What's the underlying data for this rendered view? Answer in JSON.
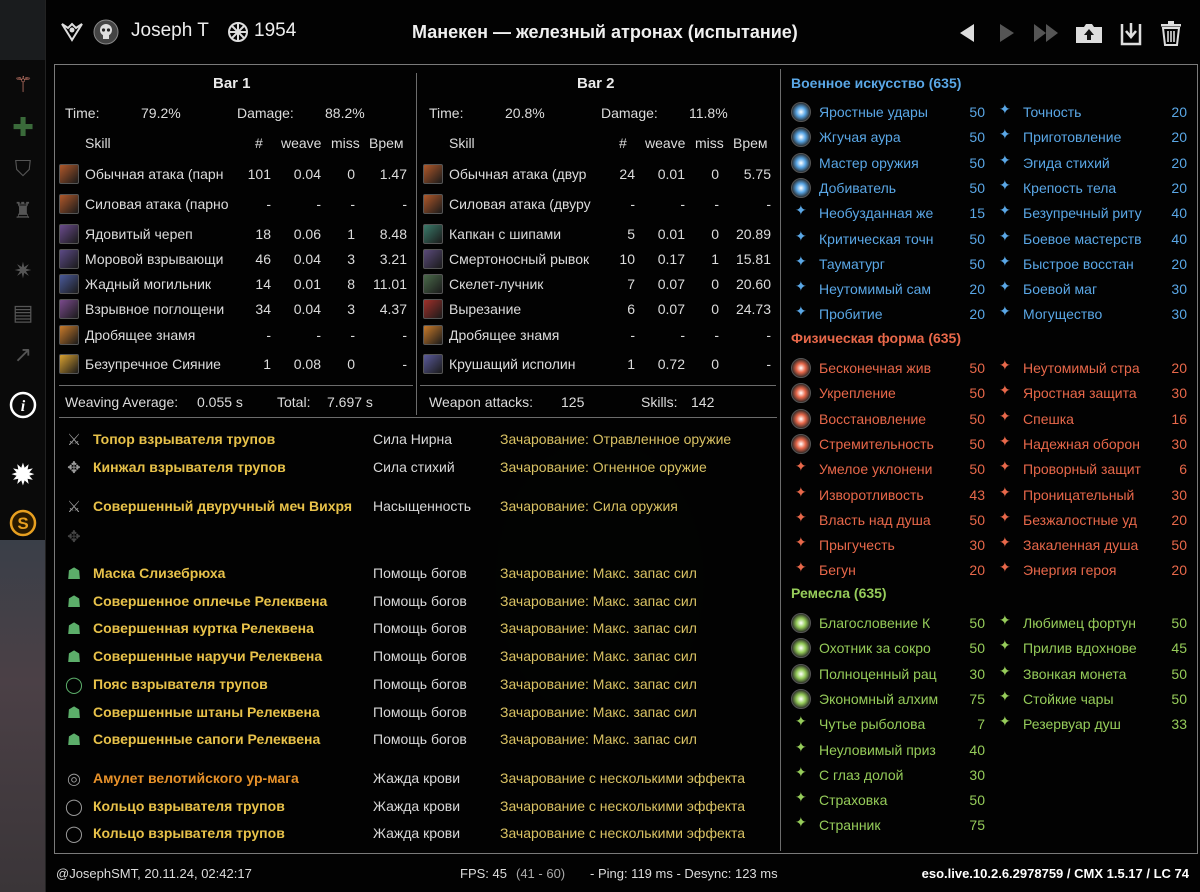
{
  "header": {
    "player": "Joseph T",
    "score": "1954",
    "title": "Манекен — железный атронах (испытание)"
  },
  "bar1": {
    "title": "Bar 1",
    "time_label": "Time:",
    "time_value": "79.2%",
    "damage_label": "Damage:",
    "damage_value": "88.2%",
    "cols": {
      "skill": "Skill",
      "num": "#",
      "weave": "weave",
      "miss": "miss",
      "time": "Врем"
    },
    "rows": [
      {
        "name": "Обычная атака (парн",
        "num": "101",
        "weave": "0.04",
        "miss": "0",
        "time": "1.47",
        "color": "#b0582a"
      },
      {
        "name": "Силовая атака (парно",
        "num": "-",
        "weave": "-",
        "miss": "-",
        "time": "-",
        "color": "#b0582a"
      },
      {
        "name": "Ядовитый череп",
        "num": "18",
        "weave": "0.06",
        "miss": "1",
        "time": "8.48",
        "color": "#6a4b8c"
      },
      {
        "name": "Моровой взрывающи",
        "num": "46",
        "weave": "0.04",
        "miss": "3",
        "time": "3.21",
        "color": "#5c4a86"
      },
      {
        "name": "Жадный могильник",
        "num": "14",
        "weave": "0.01",
        "miss": "8",
        "time": "11.01",
        "color": "#4a5a9a"
      },
      {
        "name": "Взрывное поглощени",
        "num": "34",
        "weave": "0.04",
        "miss": "3",
        "time": "4.37",
        "color": "#7a4a8c"
      },
      {
        "name": "Дробящее знамя",
        "num": "-",
        "weave": "-",
        "miss": "-",
        "time": "-",
        "color": "#c87a2a"
      },
      {
        "name": "Безупречное Сияние",
        "num": "1",
        "weave": "0.08",
        "miss": "0",
        "time": "-",
        "color": "#d8a030"
      }
    ],
    "footer_left_label": "Weaving Average:",
    "footer_left_value": "0.055 s",
    "footer_right_label": "Total:",
    "footer_right_value": "7.697 s"
  },
  "bar2": {
    "title": "Bar 2",
    "time_label": "Time:",
    "time_value": "20.8%",
    "damage_label": "Damage:",
    "damage_value": "11.8%",
    "cols": {
      "skill": "Skill",
      "num": "#",
      "weave": "weave",
      "miss": "miss",
      "time": "Врем"
    },
    "rows": [
      {
        "name": "Обычная атака (двур",
        "num": "24",
        "weave": "0.01",
        "miss": "0",
        "time": "5.75",
        "color": "#b0582a"
      },
      {
        "name": "Силовая атака (двуру",
        "num": "-",
        "weave": "-",
        "miss": "-",
        "time": "-",
        "color": "#b0582a"
      },
      {
        "name": "Капкан с шипами",
        "num": "5",
        "weave": "0.01",
        "miss": "0",
        "time": "20.89",
        "color": "#3a7a6a"
      },
      {
        "name": "Смертоносный рывок",
        "num": "10",
        "weave": "0.17",
        "miss": "1",
        "time": "15.81",
        "color": "#5a4a7a"
      },
      {
        "name": "Скелет-лучник",
        "num": "7",
        "weave": "0.07",
        "miss": "0",
        "time": "20.60",
        "color": "#4a6a4a"
      },
      {
        "name": "Вырезание",
        "num": "6",
        "weave": "0.07",
        "miss": "0",
        "time": "24.73",
        "color": "#a0302a"
      },
      {
        "name": "Дробящее знамя",
        "num": "-",
        "weave": "-",
        "miss": "-",
        "time": "-",
        "color": "#c87a2a"
      },
      {
        "name": "Крушащий исполин",
        "num": "1",
        "weave": "0.72",
        "miss": "0",
        "time": "-",
        "color": "#5a5a9a"
      }
    ],
    "footer_left_label": "Weapon attacks:",
    "footer_left_value": "125",
    "footer_right_label": "Skills:",
    "footer_right_value": "142"
  },
  "gear": [
    {
      "name": "Топор взрывателя трупов",
      "trait": "Сила Нирна",
      "ench": "Зачарование: Отравленное оружие",
      "icon": "⚔",
      "name_color": "#e8c24a"
    },
    {
      "name": "Кинжал взрывателя трупов",
      "trait": "Сила стихий",
      "ench": "Зачарование: Огненное оружие",
      "icon": "✥",
      "name_color": "#e8c24a"
    },
    {
      "name": "Совершенный двуручный меч Вихря",
      "trait": "Насыщенность",
      "ench": "Зачарование: Сила оружия",
      "icon": "⚔",
      "name_color": "#e8c24a"
    },
    {
      "name": "Маска Слизебрюха",
      "trait": "Помощь богов",
      "ench": "Зачарование: Макс. запас сил",
      "icon": "☗",
      "name_color": "#e8c24a"
    },
    {
      "name": "Совершенное оплечье Релеквена",
      "trait": "Помощь богов",
      "ench": "Зачарование: Макс. запас сил",
      "icon": "☗",
      "name_color": "#e8c24a"
    },
    {
      "name": "Совершенная куртка Релеквена",
      "trait": "Помощь богов",
      "ench": "Зачарование: Макс. запас сил",
      "icon": "☗",
      "name_color": "#e8c24a"
    },
    {
      "name": "Совершенные наручи Релеквена",
      "trait": "Помощь богов",
      "ench": "Зачарование: Макс. запас сил",
      "icon": "☗",
      "name_color": "#e8c24a"
    },
    {
      "name": "Пояс взрывателя трупов",
      "trait": "Помощь богов",
      "ench": "Зачарование: Макс. запас сил",
      "icon": "◯",
      "name_color": "#e8c24a"
    },
    {
      "name": "Совершенные штаны Релеквена",
      "trait": "Помощь богов",
      "ench": "Зачарование: Макс. запас сил",
      "icon": "☗",
      "name_color": "#e8c24a"
    },
    {
      "name": "Совершенные сапоги Релеквена",
      "trait": "Помощь богов",
      "ench": "Зачарование: Макс. запас сил",
      "icon": "☗",
      "name_color": "#e8c24a"
    },
    {
      "name": "Амулет велотийского ур-мага",
      "trait": "Жажда крови",
      "ench": "Зачарование с несколькими эффекта",
      "icon": "◎",
      "name_color": "#e8922a"
    },
    {
      "name": "Кольцо взрывателя трупов",
      "trait": "Жажда крови",
      "ench": "Зачарование с несколькими эффекта",
      "icon": "◯",
      "name_color": "#e8c24a"
    },
    {
      "name": "Кольцо взрывателя трупов",
      "trait": "Жажда крови",
      "ench": "Зачарование с несколькими эффекта",
      "icon": "◯",
      "name_color": "#e8c24a"
    }
  ],
  "cp": {
    "warfare": {
      "title": "Военное искусство (635)",
      "color": "#5aa7e6",
      "left": [
        {
          "name": "Яростные удары",
          "value": "50",
          "slotted": true
        },
        {
          "name": "Жгучая аура",
          "value": "50",
          "slotted": true
        },
        {
          "name": "Мастер оружия",
          "value": "50",
          "slotted": true
        },
        {
          "name": "Добиватель",
          "value": "50",
          "slotted": true
        },
        {
          "name": "Необузданная же",
          "value": "15",
          "slotted": false
        },
        {
          "name": "Критическая точн",
          "value": "50",
          "slotted": false
        },
        {
          "name": "Тауматург",
          "value": "50",
          "slotted": false
        },
        {
          "name": "Неутомимый сам",
          "value": "20",
          "slotted": false
        },
        {
          "name": "Пробитие",
          "value": "20",
          "slotted": false
        }
      ],
      "right": [
        {
          "name": "Точность",
          "value": "20"
        },
        {
          "name": "Приготовление",
          "value": "20"
        },
        {
          "name": "Эгида стихий",
          "value": "20"
        },
        {
          "name": "Крепость тела",
          "value": "20"
        },
        {
          "name": "Безупречный риту",
          "value": "40"
        },
        {
          "name": "Боевое мастерств",
          "value": "40"
        },
        {
          "name": "Быстрое восстан",
          "value": "20"
        },
        {
          "name": "Боевой маг",
          "value": "30"
        },
        {
          "name": "Могущество",
          "value": "30"
        }
      ]
    },
    "fitness": {
      "title": "Физическая форма (635)",
      "color": "#e8684a",
      "left": [
        {
          "name": "Бесконечная жив",
          "value": "50",
          "slotted": true
        },
        {
          "name": "Укрепление",
          "value": "50",
          "slotted": true
        },
        {
          "name": "Восстановление",
          "value": "50",
          "slotted": true
        },
        {
          "name": "Стремительность",
          "value": "50",
          "slotted": true
        },
        {
          "name": "Умелое уклонени",
          "value": "50",
          "slotted": false
        },
        {
          "name": "Изворотливость",
          "value": "43",
          "slotted": false
        },
        {
          "name": "Власть над душа",
          "value": "50",
          "slotted": false
        },
        {
          "name": "Прыгучесть",
          "value": "30",
          "slotted": false
        },
        {
          "name": "Бегун",
          "value": "20",
          "slotted": false
        }
      ],
      "right": [
        {
          "name": "Неутомимый стра",
          "value": "20"
        },
        {
          "name": "Яростная защита",
          "value": "30"
        },
        {
          "name": "Спешка",
          "value": "16"
        },
        {
          "name": "Надежная оборон",
          "value": "30"
        },
        {
          "name": "Проворный защит",
          "value": "6"
        },
        {
          "name": "Проницательный",
          "value": "30"
        },
        {
          "name": "Безжалостные уд",
          "value": "20"
        },
        {
          "name": "Закаленная душа",
          "value": "50"
        },
        {
          "name": "Энергия героя",
          "value": "20"
        }
      ]
    },
    "craft": {
      "title": "Ремесла (635)",
      "color": "#96cc5a",
      "left": [
        {
          "name": "Благословение К",
          "value": "50",
          "slotted": true
        },
        {
          "name": "Охотник за сокро",
          "value": "50",
          "slotted": true
        },
        {
          "name": "Полноценный рац",
          "value": "30",
          "slotted": true
        },
        {
          "name": "Экономный алхим",
          "value": "75",
          "slotted": true
        },
        {
          "name": "Чутье рыболова",
          "value": "7",
          "slotted": false
        },
        {
          "name": "Неуловимый приз",
          "value": "40",
          "slotted": false
        },
        {
          "name": "С глаз долой",
          "value": "30",
          "slotted": false
        },
        {
          "name": "Страховка",
          "value": "50",
          "slotted": false
        },
        {
          "name": "Странник",
          "value": "75",
          "slotted": false
        }
      ],
      "right": [
        {
          "name": "Любимец фортун",
          "value": "50"
        },
        {
          "name": "Прилив вдохнове",
          "value": "45"
        },
        {
          "name": "Звонкая монета",
          "value": "50"
        },
        {
          "name": "Стойкие чары",
          "value": "50"
        },
        {
          "name": "Резервуар душ",
          "value": "33"
        }
      ]
    }
  },
  "footer": {
    "left": "@JosephSMT, 20.11.24, 02:42:17",
    "fps_pre": "FPS: 45",
    "fps_range": "(41 - 60)",
    "fps_post": "- Ping: 119 ms - Desync: 123 ms",
    "right": "eso.live.10.2.6.2978759 / CMX 1.5.17 / LC 74"
  }
}
